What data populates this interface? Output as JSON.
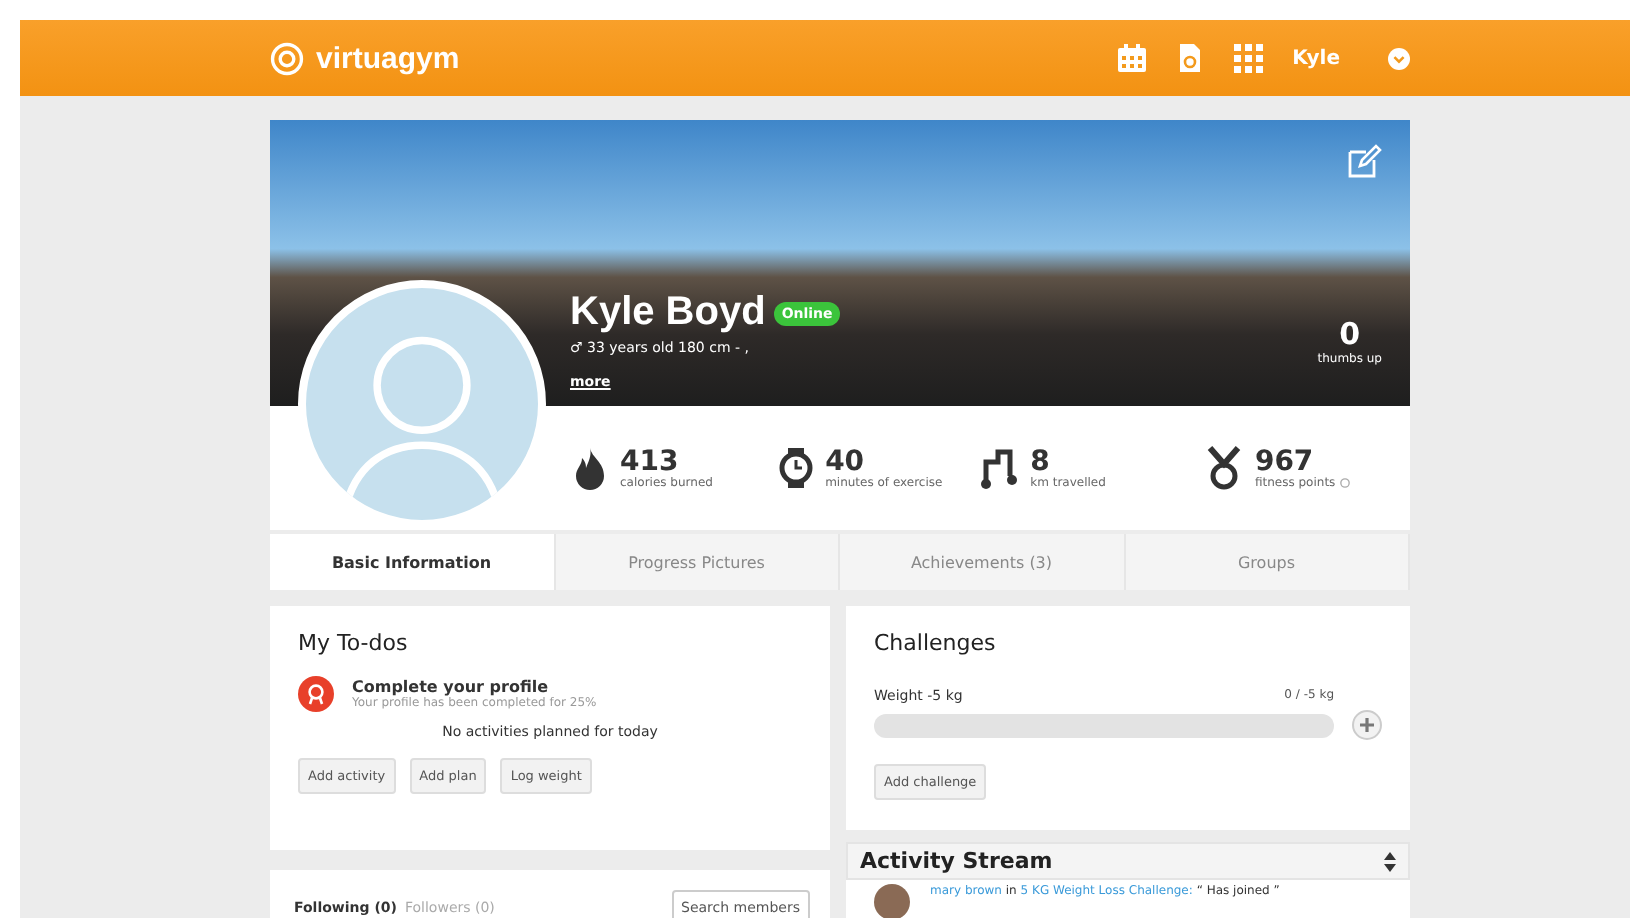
{
  "topbar": {
    "logo": "virtuagym",
    "user": "Kyle"
  },
  "profile": {
    "name": "Kyle Boyd",
    "status": "Online",
    "details": "♂ 33 years old 180 cm - ,",
    "more": "more",
    "thumbs_count": "0",
    "thumbs_label": "thumbs up"
  },
  "stats": [
    {
      "kind": "flame",
      "value": "413",
      "label": "calories burned"
    },
    {
      "kind": "watch",
      "value": "40",
      "label": "minutes of exercise"
    },
    {
      "kind": "route",
      "value": "8",
      "label": "km travelled"
    },
    {
      "kind": "medal",
      "value": "967",
      "label": "fitness points",
      "info": true
    }
  ],
  "tabs": [
    {
      "label": "Basic Information",
      "selected": true
    },
    {
      "label": "Progress Pictures",
      "selected": false
    },
    {
      "label": "Achievements (3)",
      "selected": false
    },
    {
      "label": "Groups",
      "selected": false
    }
  ],
  "todos": {
    "title": "My To-dos",
    "task_title": "Complete your profile",
    "task_text": "Your profile has been completed for 25%",
    "empty": "No activities planned for today",
    "buttons": [
      "Add activity",
      "Add plan",
      "Log weight"
    ]
  },
  "social": {
    "tabs": [
      {
        "label": "Following (0)",
        "selected": true
      },
      {
        "label": "Followers (0)",
        "selected": false
      }
    ],
    "button": "Search members"
  },
  "challenges": {
    "title": "Challenges",
    "items": [
      {
        "name": "Weight -5 kg",
        "reading": "0 / -5 kg",
        "level": 0
      }
    ],
    "button": "Add challenge"
  },
  "activity_stream": {
    "title": "Activity Stream",
    "entries": [
      {
        "user": "mary brown",
        "joiner": "in",
        "target": "5 KG Weight Loss Challenge:",
        "text": "“ Has joined ”"
      }
    ]
  }
}
